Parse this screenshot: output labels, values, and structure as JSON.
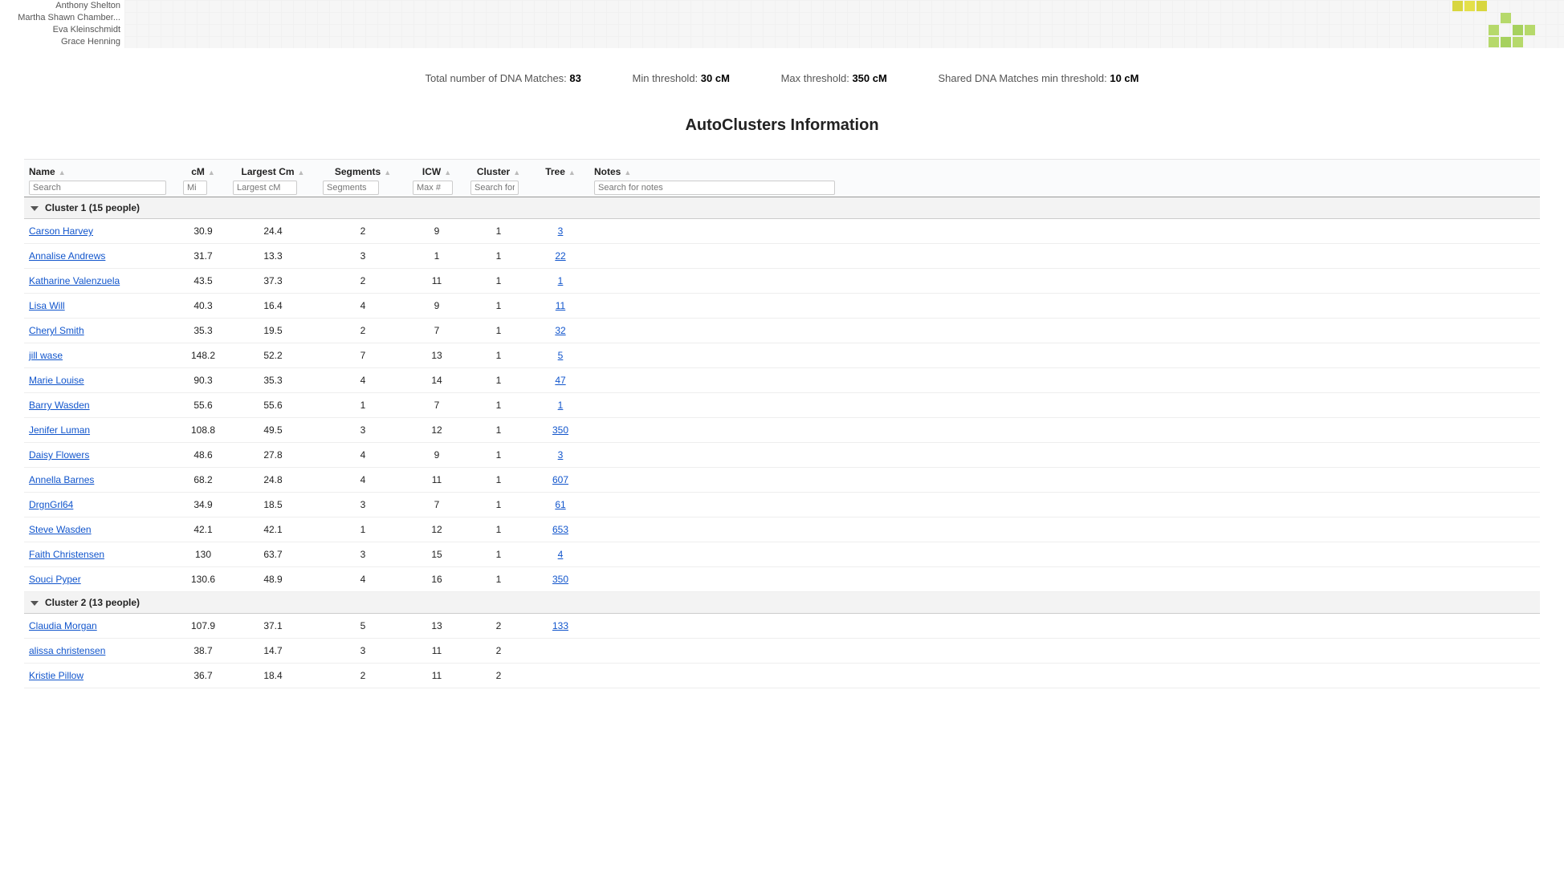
{
  "top_names": [
    "Anthony Shelton",
    "Martha Shawn Chamber...",
    "Eva Kleinschmidt",
    "Grace Henning"
  ],
  "stats": {
    "total_label": "Total number of DNA Matches:",
    "total_value": "83",
    "min_label": "Min threshold:",
    "min_value": "30 cM",
    "max_label": "Max threshold:",
    "max_value": "350 cM",
    "shared_label": "Shared DNA Matches min threshold:",
    "shared_value": "10 cM"
  },
  "section_title": "AutoClusters Information",
  "columns": {
    "name": {
      "label": "Name",
      "placeholder": "Search"
    },
    "cm": {
      "label": "cM",
      "placeholder": "Mi"
    },
    "largest": {
      "label": "Largest Cm",
      "placeholder": "Largest cM"
    },
    "segments": {
      "label": "Segments",
      "placeholder": "Segments"
    },
    "icw": {
      "label": "ICW",
      "placeholder": "Max #"
    },
    "cluster": {
      "label": "Cluster",
      "placeholder": "Search for"
    },
    "tree": {
      "label": "Tree"
    },
    "notes": {
      "label": "Notes",
      "placeholder": "Search for notes"
    }
  },
  "groups": [
    {
      "title": "Cluster 1",
      "count_text": "(15 people)",
      "rows": [
        {
          "name": "Carson Harvey",
          "cm": "30.9",
          "largest": "24.4",
          "segments": "2",
          "icw": "9",
          "cluster": "1",
          "tree": "3"
        },
        {
          "name": "Annalise Andrews",
          "cm": "31.7",
          "largest": "13.3",
          "segments": "3",
          "icw": "1",
          "cluster": "1",
          "tree": "22"
        },
        {
          "name": "Katharine Valenzuela",
          "cm": "43.5",
          "largest": "37.3",
          "segments": "2",
          "icw": "11",
          "cluster": "1",
          "tree": "1"
        },
        {
          "name": "Lisa Will",
          "cm": "40.3",
          "largest": "16.4",
          "segments": "4",
          "icw": "9",
          "cluster": "1",
          "tree": "11"
        },
        {
          "name": "Cheryl Smith",
          "cm": "35.3",
          "largest": "19.5",
          "segments": "2",
          "icw": "7",
          "cluster": "1",
          "tree": "32"
        },
        {
          "name": "jill wase",
          "cm": "148.2",
          "largest": "52.2",
          "segments": "7",
          "icw": "13",
          "cluster": "1",
          "tree": "5"
        },
        {
          "name": "Marie Louise",
          "cm": "90.3",
          "largest": "35.3",
          "segments": "4",
          "icw": "14",
          "cluster": "1",
          "tree": "47"
        },
        {
          "name": "Barry Wasden",
          "cm": "55.6",
          "largest": "55.6",
          "segments": "1",
          "icw": "7",
          "cluster": "1",
          "tree": "1"
        },
        {
          "name": "Jenifer Luman",
          "cm": "108.8",
          "largest": "49.5",
          "segments": "3",
          "icw": "12",
          "cluster": "1",
          "tree": "350"
        },
        {
          "name": "Daisy Flowers",
          "cm": "48.6",
          "largest": "27.8",
          "segments": "4",
          "icw": "9",
          "cluster": "1",
          "tree": "3"
        },
        {
          "name": "Annella Barnes",
          "cm": "68.2",
          "largest": "24.8",
          "segments": "4",
          "icw": "11",
          "cluster": "1",
          "tree": "607"
        },
        {
          "name": "DrgnGrl64",
          "cm": "34.9",
          "largest": "18.5",
          "segments": "3",
          "icw": "7",
          "cluster": "1",
          "tree": "61"
        },
        {
          "name": "Steve Wasden",
          "cm": "42.1",
          "largest": "42.1",
          "segments": "1",
          "icw": "12",
          "cluster": "1",
          "tree": "653"
        },
        {
          "name": "Faith Christensen",
          "cm": "130",
          "largest": "63.7",
          "segments": "3",
          "icw": "15",
          "cluster": "1",
          "tree": "4"
        },
        {
          "name": "Souci Pyper",
          "cm": "130.6",
          "largest": "48.9",
          "segments": "4",
          "icw": "16",
          "cluster": "1",
          "tree": "350"
        }
      ]
    },
    {
      "title": "Cluster 2",
      "count_text": "(13 people)",
      "rows": [
        {
          "name": "Claudia Morgan",
          "cm": "107.9",
          "largest": "37.1",
          "segments": "5",
          "icw": "13",
          "cluster": "2",
          "tree": "133"
        },
        {
          "name": "alissa christensen",
          "cm": "38.7",
          "largest": "14.7",
          "segments": "3",
          "icw": "11",
          "cluster": "2",
          "tree": ""
        },
        {
          "name": "Kristie Pillow",
          "cm": "36.7",
          "largest": "18.4",
          "segments": "2",
          "icw": "11",
          "cluster": "2",
          "tree": ""
        }
      ]
    }
  ]
}
